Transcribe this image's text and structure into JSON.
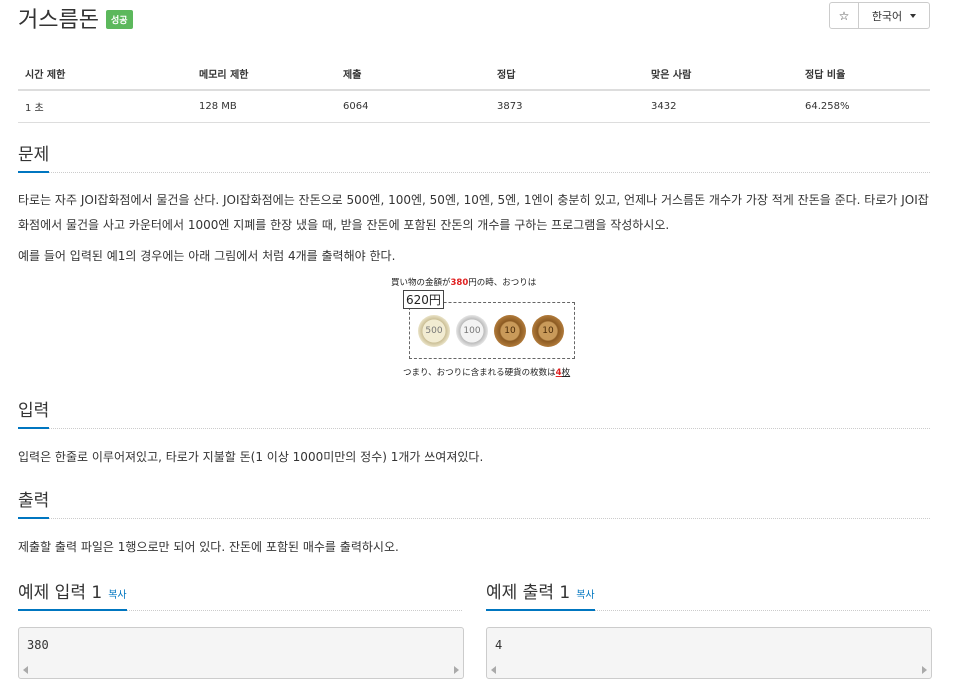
{
  "header": {
    "title": "거스름돈",
    "badge": "성공",
    "star": "☆",
    "language": "한국어"
  },
  "info_table": {
    "headers": [
      "시간 제한",
      "메모리 제한",
      "제출",
      "정답",
      "맞은 사람",
      "정답 비율"
    ],
    "row": [
      "1 초",
      "128 MB",
      "6064",
      "3873",
      "3432",
      "64.258%"
    ]
  },
  "problem": {
    "heading": "문제",
    "p1": "타로는 자주 JOI잡화점에서 물건을 산다. JOI잡화점에는 잔돈으로 500엔, 100엔, 50엔, 10엔, 5엔, 1엔이 충분히 있고, 언제나 거스름돈 개수가 가장 적게 잔돈을 준다. 타로가 JOI잡화점에서 물건을 사고 카운터에서 1000엔 지폐를 한장 냈을 때, 받을 잔돈에 포함된 잔돈의 개수를 구하는 프로그램을 작성하시오.",
    "p2": "예를 들어 입력된 예1의 경우에는 아래 그림에서 처럼 4개를 출력해야 한다."
  },
  "figure": {
    "top_pre": "買い物の金額が",
    "top_amount": "380",
    "top_post": "円の時、おつりは",
    "change_amount": "620円",
    "coins": [
      "500",
      "100",
      "10",
      "10"
    ],
    "bottom_pre": "つまり、おつりに含まれる硬貨の枚数は",
    "bottom_count": "4",
    "bottom_unit": "枚"
  },
  "input": {
    "heading": "입력",
    "text": "입력은 한줄로 이루어져있고, 타로가 지불할 돈(1 이상 1000미만의 정수) 1개가 쓰여져있다."
  },
  "output": {
    "heading": "출력",
    "text": "제출할 출력 파일은 1행으로만 되어 있다. 잔돈에 포함된 매수를 출력하시오."
  },
  "examples": {
    "input_heading": "예제 입력 1",
    "output_heading": "예제 출력 1",
    "copy_label": "복사",
    "input_value": "380",
    "output_value": "4"
  }
}
